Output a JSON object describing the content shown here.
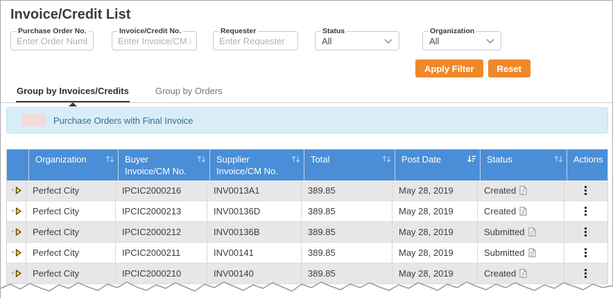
{
  "page": {
    "title": "Invoice/Credit List"
  },
  "filters": {
    "purchase_order": {
      "label": "Purchase Order No.",
      "placeholder": "Enter Order Number",
      "value": ""
    },
    "invoice_credit": {
      "label": "Invoice/Credit No.",
      "placeholder": "Enter Invoice/CM No.",
      "value": ""
    },
    "requester": {
      "label": "Requester",
      "placeholder": "Enter Requester",
      "value": ""
    },
    "status": {
      "label": "Status",
      "value": "All"
    },
    "organization": {
      "label": "Organization",
      "value": "All"
    },
    "apply_label": "Apply Filter",
    "reset_label": "Reset"
  },
  "tabs": {
    "group_by_invoices": "Group by Invoices/Credits",
    "group_by_orders": "Group by Orders",
    "active": "Group by Invoices/Credits"
  },
  "banner": {
    "text": "Purchase Orders with Final Invoice"
  },
  "table": {
    "columns": [
      {
        "label": "Organization",
        "sort": "inactive"
      },
      {
        "label": "Buyer Invoice/CM No.",
        "sort": "inactive"
      },
      {
        "label": "Supplier Invoice/CM No.",
        "sort": "inactive"
      },
      {
        "label": "Total",
        "sort": "inactive"
      },
      {
        "label": "Post Date",
        "sort": "desc"
      },
      {
        "label": "Status",
        "sort": "inactive"
      },
      {
        "label": "Actions",
        "sort": "none"
      }
    ],
    "rows": [
      {
        "organization": "Perfect City",
        "buyer_invoice": "IPCIC2000216",
        "supplier_invoice": "INV0013A1",
        "total": "389.85",
        "post_date": "May 28, 2019",
        "status": "Created"
      },
      {
        "organization": "Perfect City",
        "buyer_invoice": "IPCIC2000213",
        "supplier_invoice": "INV00136D",
        "total": "389.85",
        "post_date": "May 28, 2019",
        "status": "Created"
      },
      {
        "organization": "Perfect City",
        "buyer_invoice": "IPCIC2000212",
        "supplier_invoice": "INV00136B",
        "total": "389.85",
        "post_date": "May 28, 2019",
        "status": "Submitted"
      },
      {
        "organization": "Perfect City",
        "buyer_invoice": "IPCIC2000211",
        "supplier_invoice": "INV00141",
        "total": "389.85",
        "post_date": "May 28, 2019",
        "status": "Submitted"
      },
      {
        "organization": "Perfect City",
        "buyer_invoice": "IPCIC2000210",
        "supplier_invoice": "INV00140",
        "total": "389.85",
        "post_date": "May 28, 2019",
        "status": "Created"
      }
    ]
  },
  "icons": {
    "dropdown": "chevron-down-icon",
    "sort_inactive": "sort-arrows-icon",
    "sort_active": "sort-descending-icon",
    "row_expand": "expand-arrow-icon",
    "status_doc": "document-icon",
    "actions": "kebab-menu-icon"
  },
  "colors": {
    "header_blue": "#4a8ed7",
    "accent_orange": "#ef8829",
    "banner_bg": "#d9edf7",
    "banner_text": "#31708f",
    "banner_swatch": "#f6dada",
    "row_stripe": "#e7e7e7",
    "expand_arrow_fill": "#ffd34d"
  }
}
